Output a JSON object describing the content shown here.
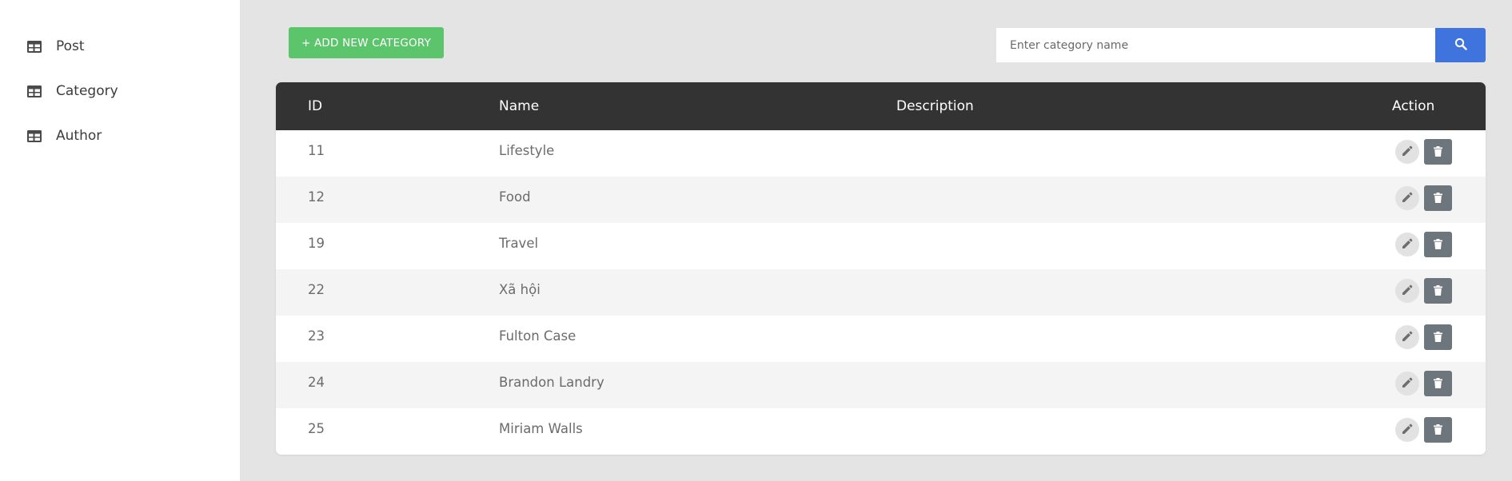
{
  "sidebar": {
    "items": [
      {
        "label": "Post",
        "icon": "table-icon"
      },
      {
        "label": "Category",
        "icon": "table-icon"
      },
      {
        "label": "Author",
        "icon": "table-icon"
      }
    ]
  },
  "toolbar": {
    "add_label": "+ ADD NEW CATEGORY",
    "search_placeholder": "Enter category name",
    "search_value": ""
  },
  "table": {
    "columns": [
      "ID",
      "Name",
      "Description",
      "Action"
    ],
    "rows": [
      {
        "id": "11",
        "name": "Lifestyle",
        "description": ""
      },
      {
        "id": "12",
        "name": "Food",
        "description": ""
      },
      {
        "id": "19",
        "name": "Travel",
        "description": ""
      },
      {
        "id": "22",
        "name": "Xã hội",
        "description": ""
      },
      {
        "id": "23",
        "name": "Fulton Case",
        "description": ""
      },
      {
        "id": "24",
        "name": "Brandon Landry",
        "description": ""
      },
      {
        "id": "25",
        "name": "Miriam Walls",
        "description": ""
      }
    ]
  },
  "colors": {
    "add_button": "#5cc46b",
    "search_button": "#3f74de",
    "table_header": "#333333",
    "delete_button": "#6d757d",
    "page_background": "#e4e4e4"
  }
}
